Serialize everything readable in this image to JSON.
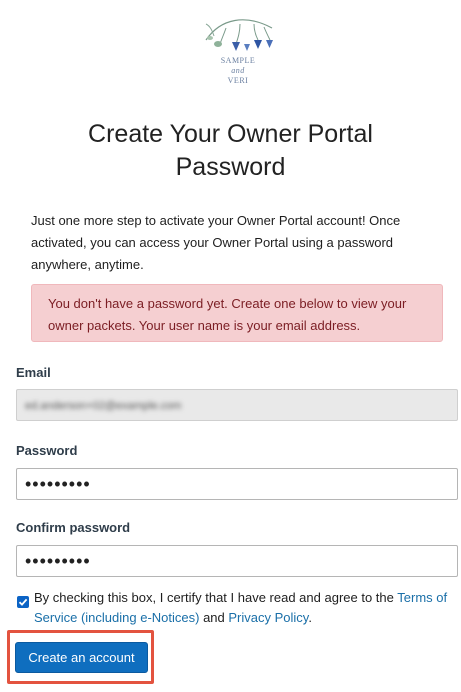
{
  "logo": {
    "line1": "SAMPLE",
    "line2": "and",
    "line3": "VERI"
  },
  "page": {
    "title_line1": "Create Your Owner Portal",
    "title_line2": "Password",
    "intro": "Just one more step to activate your Owner Portal account! Once activated, you can access your Owner Portal using a password anywhere, anytime.",
    "alert": "You don't have a password yet. Create one below to view your owner packets. Your user name is your email address."
  },
  "form": {
    "email_label": "Email",
    "email_value": "ed.anderson+02@example.com",
    "password_label": "Password",
    "password_value": "•••••••••",
    "confirm_label": "Confirm password",
    "confirm_value": "•••••••••",
    "consent_prefix": "By checking this box, I certify that I have read and agree to the ",
    "terms_link": "Terms of Service (including e-Notices)",
    "consent_and": " and ",
    "privacy_link": "Privacy Policy",
    "consent_suffix": ".",
    "consent_checked": true,
    "submit_label": "Create an account"
  },
  "colors": {
    "accent": "#0f6ebf",
    "alert_bg": "#f5cfd1",
    "highlight": "#e3533f",
    "link": "#1a6fa8"
  }
}
